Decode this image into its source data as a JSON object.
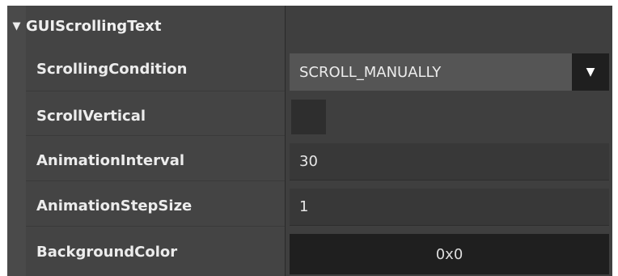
{
  "section": {
    "title": "GUIScrollingText",
    "toggle_glyph": "▼"
  },
  "properties": {
    "scrolling_condition": {
      "label": "ScrollingCondition",
      "value": "SCROLL_MANUALLY",
      "arrow_glyph": "▼"
    },
    "scroll_vertical": {
      "label": "ScrollVertical",
      "checked": false
    },
    "animation_interval": {
      "label": "AnimationInterval",
      "value": "30"
    },
    "animation_step_size": {
      "label": "AnimationStepSize",
      "value": "1"
    },
    "background_color": {
      "label": "BackgroundColor",
      "value": "0x0",
      "swatch": "#000000"
    }
  }
}
